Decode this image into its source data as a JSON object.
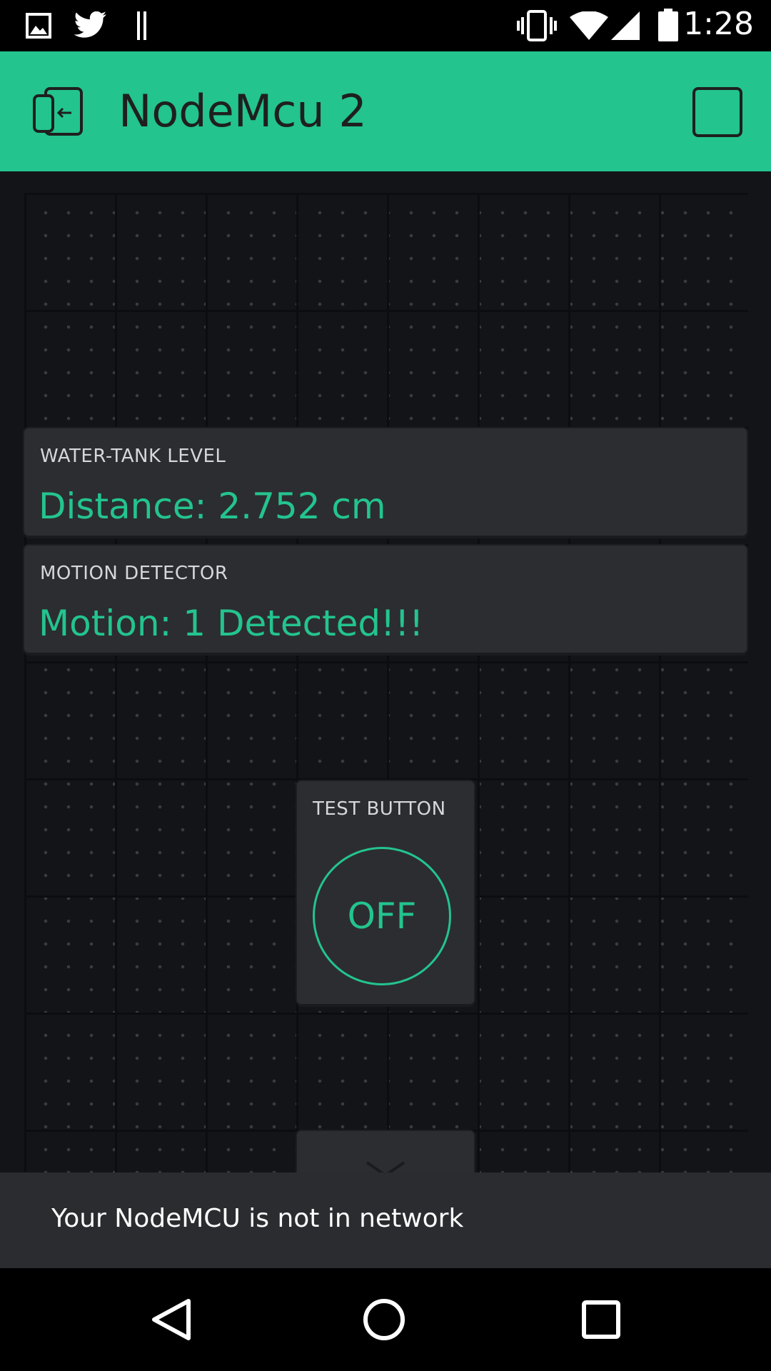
{
  "status_bar": {
    "time": "1:28",
    "left_icons": [
      "image-icon",
      "twitter-icon",
      "pause-icon"
    ],
    "right_icons": [
      "vibrate-icon",
      "wifi-icon",
      "signal-icon",
      "battery-icon"
    ]
  },
  "app_bar": {
    "title": "NodeMcu 2",
    "left_icon": "exit-icon",
    "right_icon": "stop-icon",
    "background_color": "#23c48e"
  },
  "widgets": {
    "water_tank": {
      "label": "WATER-TANK LEVEL",
      "value": "Distance: 2.752 cm"
    },
    "motion": {
      "label": "MOTION DETECTOR",
      "value": "Motion: 1 Detected!!!"
    },
    "test_button": {
      "label": "TEST BUTTON",
      "state": "OFF"
    }
  },
  "snackbar": {
    "message": "Your NodeMCU is not in network"
  },
  "nav_bar": {
    "icons": [
      "back-icon",
      "home-icon",
      "recents-icon"
    ]
  },
  "colors": {
    "accent": "#23c48e",
    "widget_bg": "#2c2d31",
    "canvas_bg": "#131418"
  }
}
